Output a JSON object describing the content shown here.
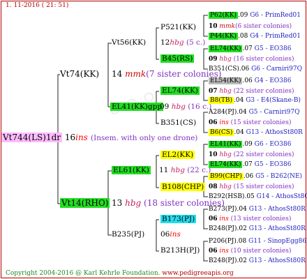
{
  "header": {
    "date_line": "1. 11-2016 ( 21: 51)"
  },
  "footer": {
    "copyright": "Copyright 2004-2016 @ Karl Kehrle Foundation.",
    "url": "www.pedigreeapis.org"
  },
  "root": {
    "id": "Vt744(LS)1dr",
    "year": "16",
    "breed": "ins",
    "note": "(Insem. with only one drone)"
  },
  "gen1": {
    "sire": {
      "id": "Vt74(KK)",
      "year": "14",
      "breed": "mmk",
      "sisters": "(7 sister colonies)"
    },
    "dam": {
      "id": "Vt14(RHO)",
      "year": "13",
      "breed": "hbg",
      "sisters": "(18 sister colonies)"
    }
  },
  "gen2": {
    "a": {
      "id": "Vt56(KK)"
    },
    "b": {
      "id": "EL41(KK)gpp",
      "year": "09",
      "breed": "hbg",
      "sisters": "(16 c.)"
    },
    "c": {
      "id": "EL61(KK)",
      "year": "11",
      "breed": "hbg",
      "sisters": "(22 c.)"
    },
    "d": {
      "id": "B235(PJ)"
    }
  },
  "gen3": {
    "a": {
      "id": "P521(KK)",
      "year": "12",
      "breed": "hbg",
      "sisters": "(5 c.)"
    },
    "b": {
      "id": "B45(RS)"
    },
    "c": {
      "id": "EL74(KK)"
    },
    "d": {
      "id": "B351(CS)"
    },
    "e": {
      "id": "EL2(KK)"
    },
    "f": {
      "id": "B108(CHP)"
    },
    "g": {
      "id": "B173(PJ)",
      "year": "06",
      "breed": "ins"
    },
    "h": {
      "id": "B213H(PJ)",
      "year": "10",
      "breed": "ins"
    }
  },
  "gen4": [
    {
      "id": "P62(KK)",
      "year": ".09",
      "sire": "G6 - PrimRed01"
    },
    {
      "year": "10",
      "breed": "mmk",
      "sisters": "(6 sister colonies)"
    },
    {
      "id": "P44(KK)",
      "year": ".08",
      "sire": "G4 - PrimRed01"
    },
    {
      "id": "EL74(KK)",
      "year": ".07",
      "sire": "G5 - EO386"
    },
    {
      "year": "09",
      "breed": "hbg",
      "sisters": "(16 sister colonies)"
    },
    {
      "id": "B351(CS)",
      "year": ".06",
      "sire": "G6 - Carniri97Q"
    },
    {
      "id": "EL54(KK)",
      "year": ".06",
      "sire": "G4 - EO386"
    },
    {
      "year": "07",
      "breed": "hbg",
      "sisters": "(22 sister colonies)"
    },
    {
      "id": "B8(TB)",
      "year": ".04",
      "sire": "G3 - E4(Skane-B)"
    },
    {
      "id": "A284(PJ)",
      "year": ".04",
      "sire": "G5 - Carniri97Q"
    },
    {
      "year": "06",
      "breed": "ins",
      "sisters": "(15 sister colonies)"
    },
    {
      "id": "B6(CS)",
      "year": ".04",
      "sire": "G13 - AthosSt80R"
    },
    {
      "id": "EL41(KK)",
      "year": ".09",
      "sire": "G6 - EO386"
    },
    {
      "year": "10",
      "breed": "hbg",
      "sisters": "(22 sister colonies)"
    },
    {
      "id": "EL74(KK)",
      "year": ".07",
      "sire": "G5 - EO386"
    },
    {
      "id": "B99(CHP)",
      "year": ".06",
      "sire": "G5 - B262(NE)"
    },
    {
      "year": "08",
      "breed": "hbg",
      "sisters": "(15 sister colonies)"
    },
    {
      "id": "B292(HSB)",
      "year": ".05",
      "sire": "G14 - AthosSt80R"
    },
    {
      "id": "B273(PJ)",
      "year": ".04",
      "sire": "G13 - AthosSt80R"
    },
    {
      "year": "06",
      "breed": "ins",
      "sisters": "(13 sister colonies)"
    },
    {
      "id": "B248(PJ)",
      "year": ".02",
      "sire": "G13 - AthosSt80R"
    },
    {
      "id": "P206(PJ)",
      "year": ".08",
      "sire": "G11 - SinopEgg86R"
    },
    {
      "year": "06",
      "breed": "ins",
      "sisters": "(10 sister colonies)"
    },
    {
      "id": "B248(PJ)",
      "year": ".02",
      "sire": "G13 - AthosSt80R"
    }
  ],
  "colors": {
    "green": "#22dd22",
    "yellow": "#ffff00",
    "cyan": "#22ddee",
    "pink": "#ffbbff",
    "gray": "#bbbbbb",
    "frame": "#b00000"
  }
}
